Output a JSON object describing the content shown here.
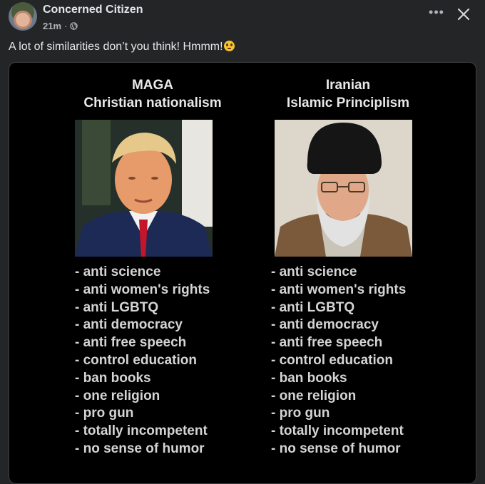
{
  "post": {
    "author": "Concerned Citizen",
    "time": "21m",
    "separator": "·",
    "more_label": "•••",
    "caption": "A lot of similarities don’t you think! Hmmm!"
  },
  "image": {
    "left": {
      "title_line1": "MAGA",
      "title_line2": "Christian nationalism",
      "items": [
        "- anti science",
        "- anti women's rights",
        "- anti LGBTQ",
        "- anti democracy",
        "- anti free speech",
        "- control education",
        "- ban books",
        "- one religion",
        "- pro gun",
        "- totally incompetent",
        "- no sense of humor"
      ]
    },
    "right": {
      "title_line1": "Iranian",
      "title_line2": "Islamic Principlism",
      "items": [
        "- anti science",
        "- anti women's rights",
        "- anti LGBTQ",
        "- anti democracy",
        "- anti free speech",
        "- control education",
        "- ban books",
        "- one religion",
        "- pro gun",
        "- totally incompetent",
        "- no sense of humor"
      ]
    }
  },
  "icons": {
    "privacy": "globe-icon",
    "more": "more-options-icon",
    "close": "close-icon",
    "emoji": "flushed-face-emoji-icon"
  },
  "colors": {
    "background": "#242526",
    "primary_text": "#e4e6eb",
    "secondary_text": "#b0b3b8",
    "image_background": "#000000"
  }
}
